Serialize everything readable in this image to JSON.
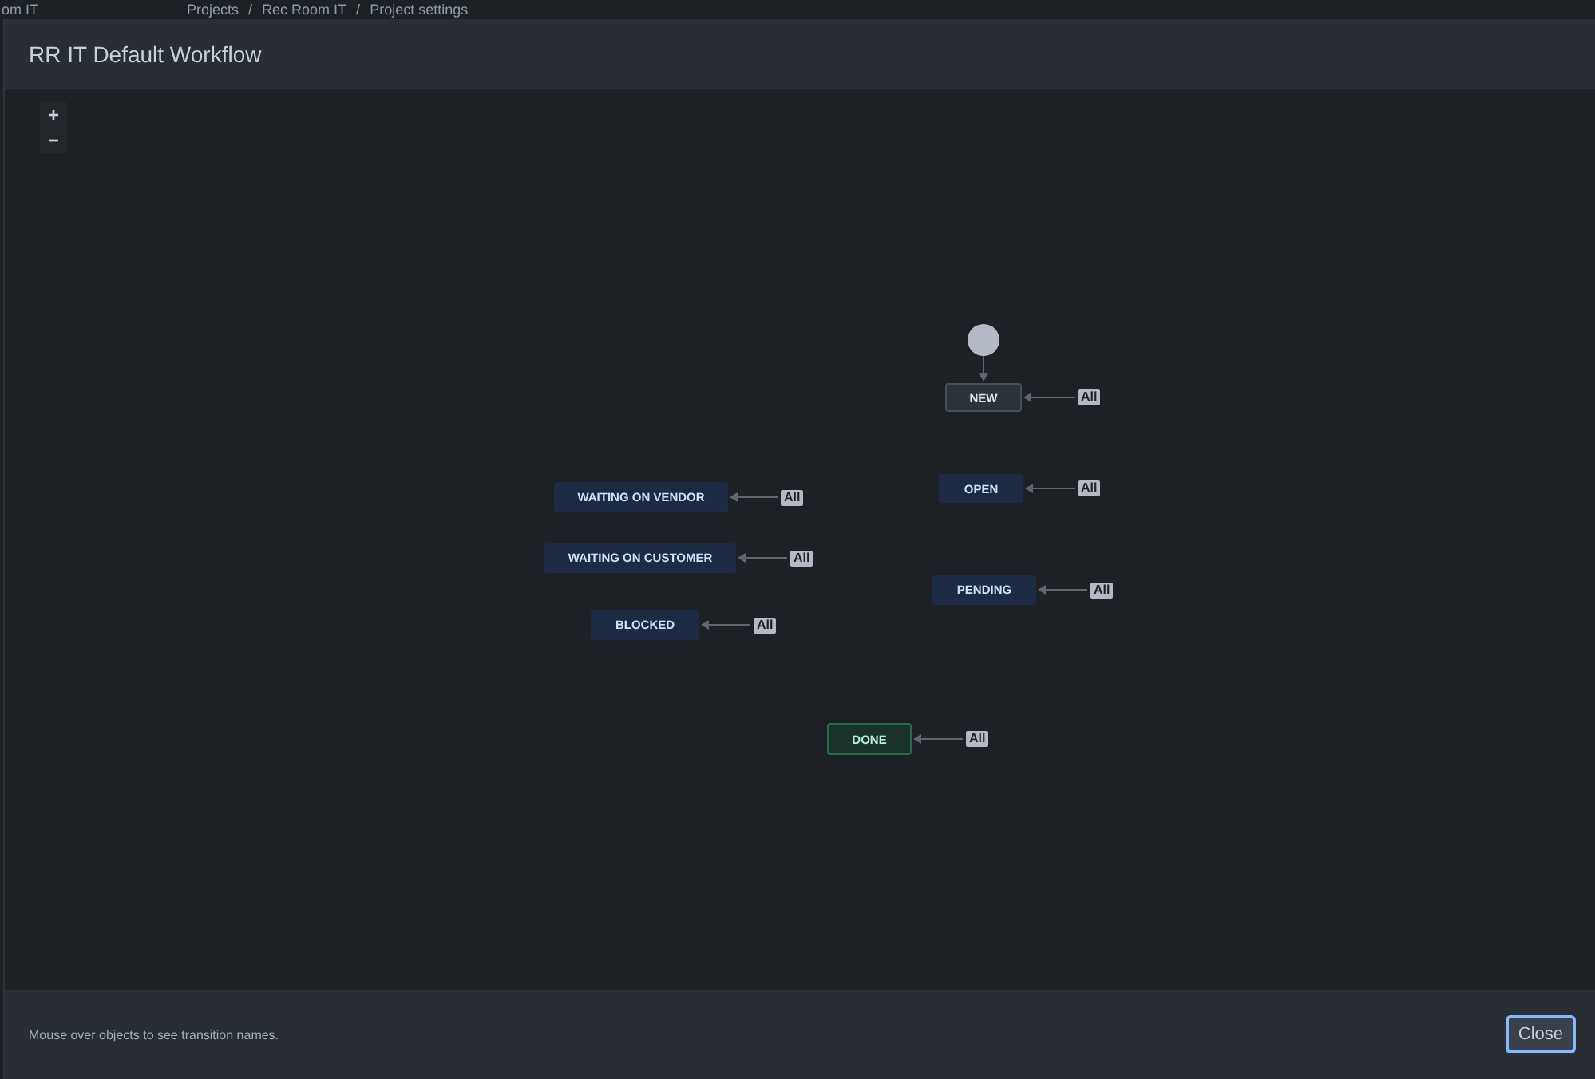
{
  "background": {
    "sidebar_text": "om IT",
    "breadcrumb": [
      "Projects",
      "Rec Room IT",
      "Project settings"
    ],
    "breadcrumb_separator": "/"
  },
  "dialog": {
    "title": "RR IT Default Workflow",
    "zoom_controls": [
      "+",
      "−"
    ],
    "statuses": [
      {
        "label": "NEW",
        "kind": "todo",
        "transition": "All"
      },
      {
        "label": "OPEN",
        "kind": "inprogress",
        "transition": "All"
      },
      {
        "label": "WAITING ON VENDOR",
        "kind": "inprogress",
        "transition": "All"
      },
      {
        "label": "WAITING ON CUSTOMER",
        "kind": "inprogress",
        "transition": "All"
      },
      {
        "label": "PENDING",
        "kind": "inprogress",
        "transition": "All"
      },
      {
        "label": "BLOCKED",
        "kind": "inprogress",
        "transition": "All"
      },
      {
        "label": "DONE",
        "kind": "done",
        "transition": "All"
      }
    ],
    "hint": "Mouse over objects to see transition names.",
    "buttons": [
      "Close"
    ]
  }
}
